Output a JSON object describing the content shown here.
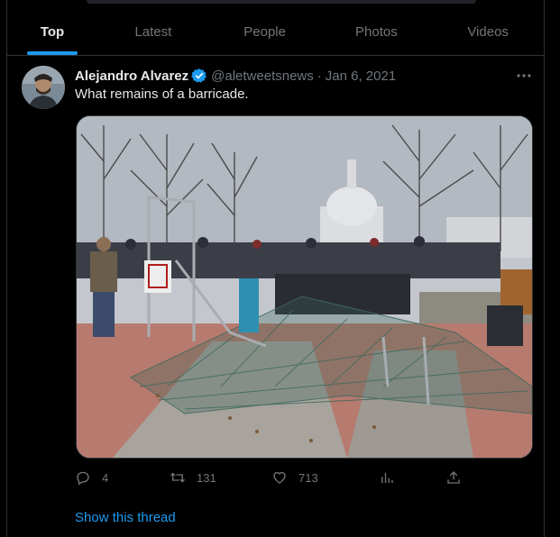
{
  "tabs": [
    {
      "label": "Top",
      "active": true
    },
    {
      "label": "Latest"
    },
    {
      "label": "People"
    },
    {
      "label": "Photos"
    },
    {
      "label": "Videos"
    }
  ],
  "tweet": {
    "author_name": "Alejandro Alvarez",
    "handle": "@aletweetsnews",
    "separator": "·",
    "date": "Jan 6, 2021",
    "text": "What remains of a barricade.",
    "image_alt": "What remains of a barricade.",
    "stats": {
      "replies": "4",
      "retweets": "131",
      "likes": "713"
    },
    "show_thread": "Show this thread",
    "verified": true
  },
  "colors": {
    "accent": "#1d9bf0",
    "muted": "#71767b",
    "text": "#e7e9ea",
    "background": "#000000"
  },
  "icons": {
    "verified": "verified-badge-icon",
    "more": "more-icon",
    "reply": "reply-icon",
    "retweet": "retweet-icon",
    "like": "heart-icon",
    "views": "views-icon",
    "share": "share-icon"
  }
}
